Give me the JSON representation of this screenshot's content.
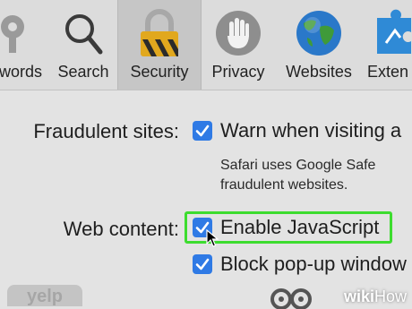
{
  "toolbar": {
    "items": [
      {
        "label": "words",
        "icon": "key-icon"
      },
      {
        "label": "Search",
        "icon": "magnifier-icon"
      },
      {
        "label": "Security",
        "icon": "lock-icon",
        "selected": true
      },
      {
        "label": "Privacy",
        "icon": "hand-icon"
      },
      {
        "label": "Websites",
        "icon": "globe-icon"
      },
      {
        "label": "Exten",
        "icon": "puzzle-icon"
      }
    ]
  },
  "security": {
    "fraudulent_label": "Fraudulent sites:",
    "warn_option": "Warn when visiting a",
    "warn_checked": true,
    "warn_desc_line1": "Safari uses Google Safe",
    "warn_desc_line2": "fraudulent websites.",
    "web_content_label": "Web content:",
    "javascript_option": "Enable JavaScript",
    "javascript_checked": true,
    "popup_option": "Block pop-up window",
    "popup_checked": true
  },
  "background": {
    "logo_text": "yelp"
  },
  "watermark": {
    "part1": "wiki",
    "part2": "How"
  },
  "colors": {
    "checkbox": "#2f7ae5",
    "highlight": "#3ddc2f"
  }
}
